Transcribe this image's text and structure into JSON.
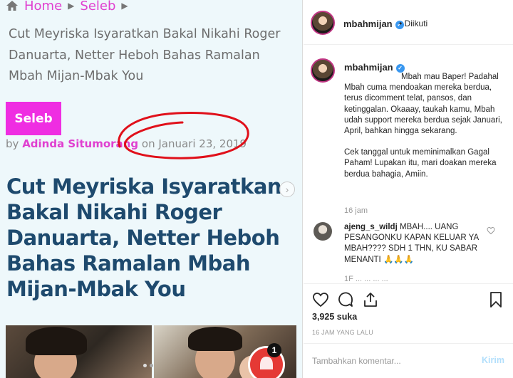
{
  "article": {
    "breadcrumb": {
      "home": "Home",
      "section": "Seleb"
    },
    "header_title": "Cut Meyriska Isyaratkan Bakal Nikahi Roger Danuarta, Netter Heboh Bahas Ramalan Mbah Mijan-Mbak You",
    "category_badge": "Seleb",
    "byline_by": "by",
    "author": "Adinda Situmorang",
    "byline_on": "on",
    "date": "Januari 23, 2019",
    "headline": "Cut Meyriska Isyaratkan Bakal Nikahi Roger Danuarta, Netter Heboh Bahas Ramalan Mbah Mijan-Mbak You",
    "next_arrow": "›",
    "notification_count": "1"
  },
  "instagram": {
    "username": "mbahmijan",
    "verified_mark": "✓",
    "follow_state": "• Diikuti",
    "caption_paragraphs": [
      "Mbah mau Baper! Padahal Mbah cuma mendoakan mereka berdua, terus dicomment telat, pansos, dan ketinggalan. Okaaay, taukah kamu, Mbah udah support mereka berdua sejak Januari, April, bahkan hingga sekarang.",
      "Cek tanggal untuk meminimalkan Gagal Paham! Lupakan itu, mari doakan mereka berdua bahagia, Amiin."
    ],
    "caption_time": "16 jam",
    "comment": {
      "username": "ajeng_s_wildj",
      "text": "MBAH.... UANG PESANGONKU KAPAN KELUAR YA MBAH???? SDH 1 THN, KU SABAR MENANTI 🙏🙏🙏"
    },
    "clipped_line": "1F ... ... ... ...",
    "likes": "3,925 suka",
    "post_time": "16 JAM YANG LALU",
    "comment_placeholder": "Tambahkan komentar...",
    "post_button": "Kirim"
  },
  "colors": {
    "accent_pink": "#ef2de2",
    "headline_blue": "#1e4a6e",
    "annotation_red": "#e0101a",
    "verified_blue": "#3897f0",
    "post_button_blue": "#b2dffc"
  },
  "icons": [
    "home-icon",
    "chevron-right-icon",
    "heart-icon",
    "comment-icon",
    "share-icon",
    "bookmark-icon",
    "bell-icon",
    "verified-icon"
  ]
}
